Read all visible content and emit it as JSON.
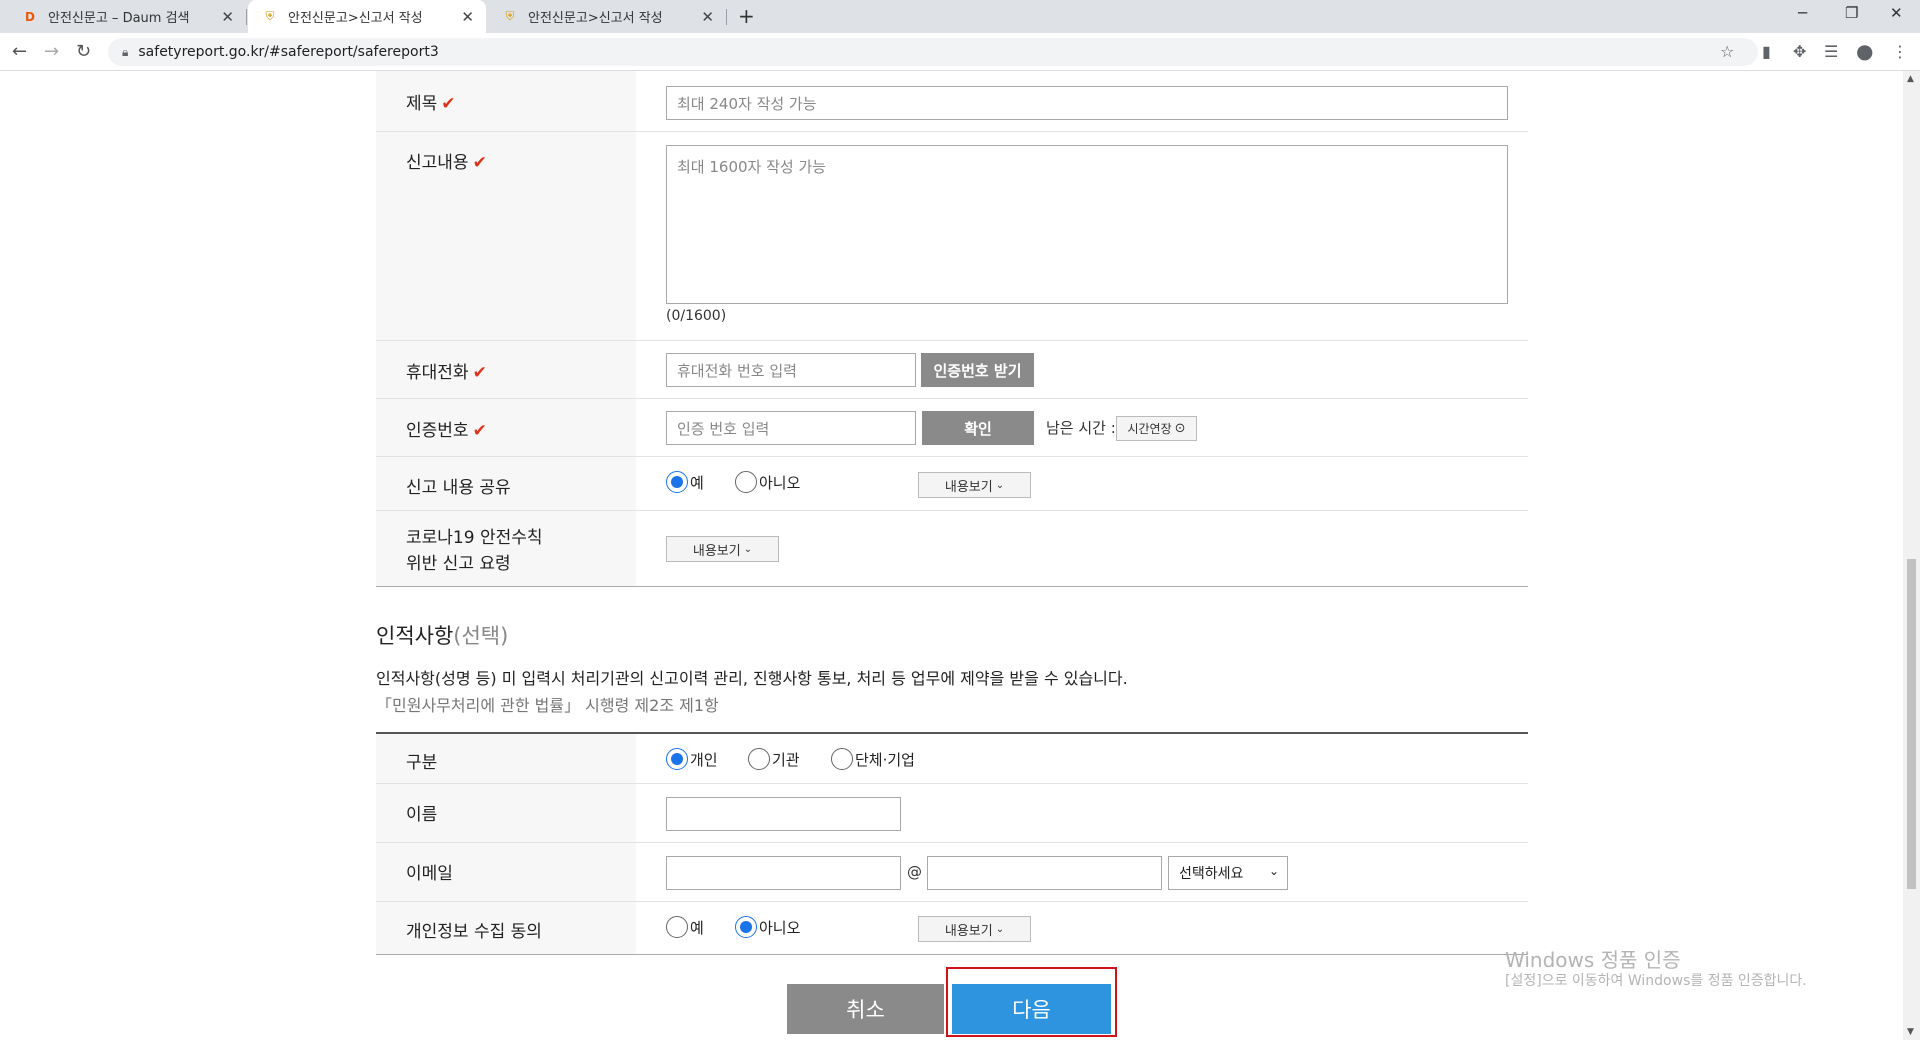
{
  "browser": {
    "tabs": [
      {
        "title": "안전신문고 – Daum 검색"
      },
      {
        "title": "안전신문고>신고서 작성"
      },
      {
        "title": "안전신문고>신고서 작성"
      }
    ],
    "url": "safetyreport.go.kr/#safereport/safereport3"
  },
  "form": {
    "title": {
      "label": "제목",
      "placeholder": "최대 240자 작성 가능"
    },
    "content": {
      "label": "신고내용",
      "placeholder": "최대 1600자 작성 가능",
      "counter": "(0/1600)"
    },
    "phone": {
      "label": "휴대전화",
      "placeholder": "휴대전화 번호 입력",
      "button": "인증번호 받기"
    },
    "auth": {
      "label": "인증번호",
      "placeholder": "인증 번호 입력",
      "button": "확인",
      "remaining": "남은 시간 :",
      "extend": "시간연장"
    },
    "share": {
      "label": "신고 내용 공유",
      "yes": "예",
      "no": "아니오",
      "view": "내용보기",
      "selected": "예"
    },
    "covid": {
      "label_line1": "코로나19 안전수칙",
      "label_line2": "위반 신고 요령",
      "view": "내용보기"
    }
  },
  "personal": {
    "section_title": "인적사항",
    "section_optional": "(선택)",
    "notice": "인적사항(성명 등) 미 입력시 처리기관의 신고이력 관리, 진행사항 통보, 처리 등 업무에 제약을 받을 수 있습니다.",
    "law": "「민원사무처리에 관한 법률」 시행령 제2조 제1항",
    "type": {
      "label": "구분",
      "options": [
        "개인",
        "기관",
        "단체·기업"
      ],
      "selected": "개인"
    },
    "name": {
      "label": "이름",
      "value": ""
    },
    "email": {
      "label": "이메일",
      "at": "@",
      "select": "선택하세요"
    },
    "consent": {
      "label": "개인정보 수집 동의",
      "yes": "예",
      "no": "아니오",
      "view": "내용보기",
      "selected": "아니오"
    }
  },
  "actions": {
    "cancel": "취소",
    "next": "다음"
  },
  "watermark": {
    "line1": "Windows 정품 인증",
    "line2": "[설정]으로 이동하여 Windows를 정품 인증합니다."
  }
}
